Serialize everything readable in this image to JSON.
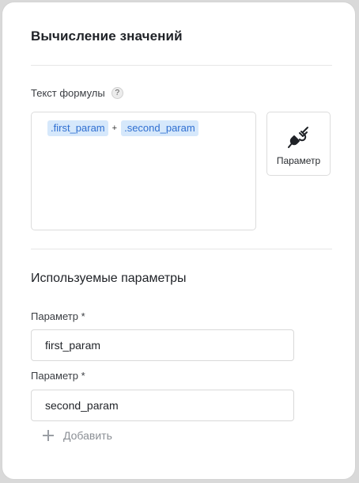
{
  "header": {
    "title": "Вычисление значений"
  },
  "formula": {
    "label": "Текст формулы",
    "help_icon": "?",
    "tokens": [
      ".first_param",
      ".second_param"
    ],
    "operator": "+"
  },
  "param_button": {
    "label": "Параметр",
    "icon": "plug-icon"
  },
  "used_params": {
    "title": "Используемые параметры",
    "fields": [
      {
        "label": "Параметр *",
        "value": "first_param"
      },
      {
        "label": "Параметр *",
        "value": "second_param"
      }
    ],
    "add_label": "Добавить"
  },
  "colors": {
    "token_bg": "#d6e8fb",
    "token_text": "#2f6fd1",
    "muted": "#8b8f95"
  }
}
